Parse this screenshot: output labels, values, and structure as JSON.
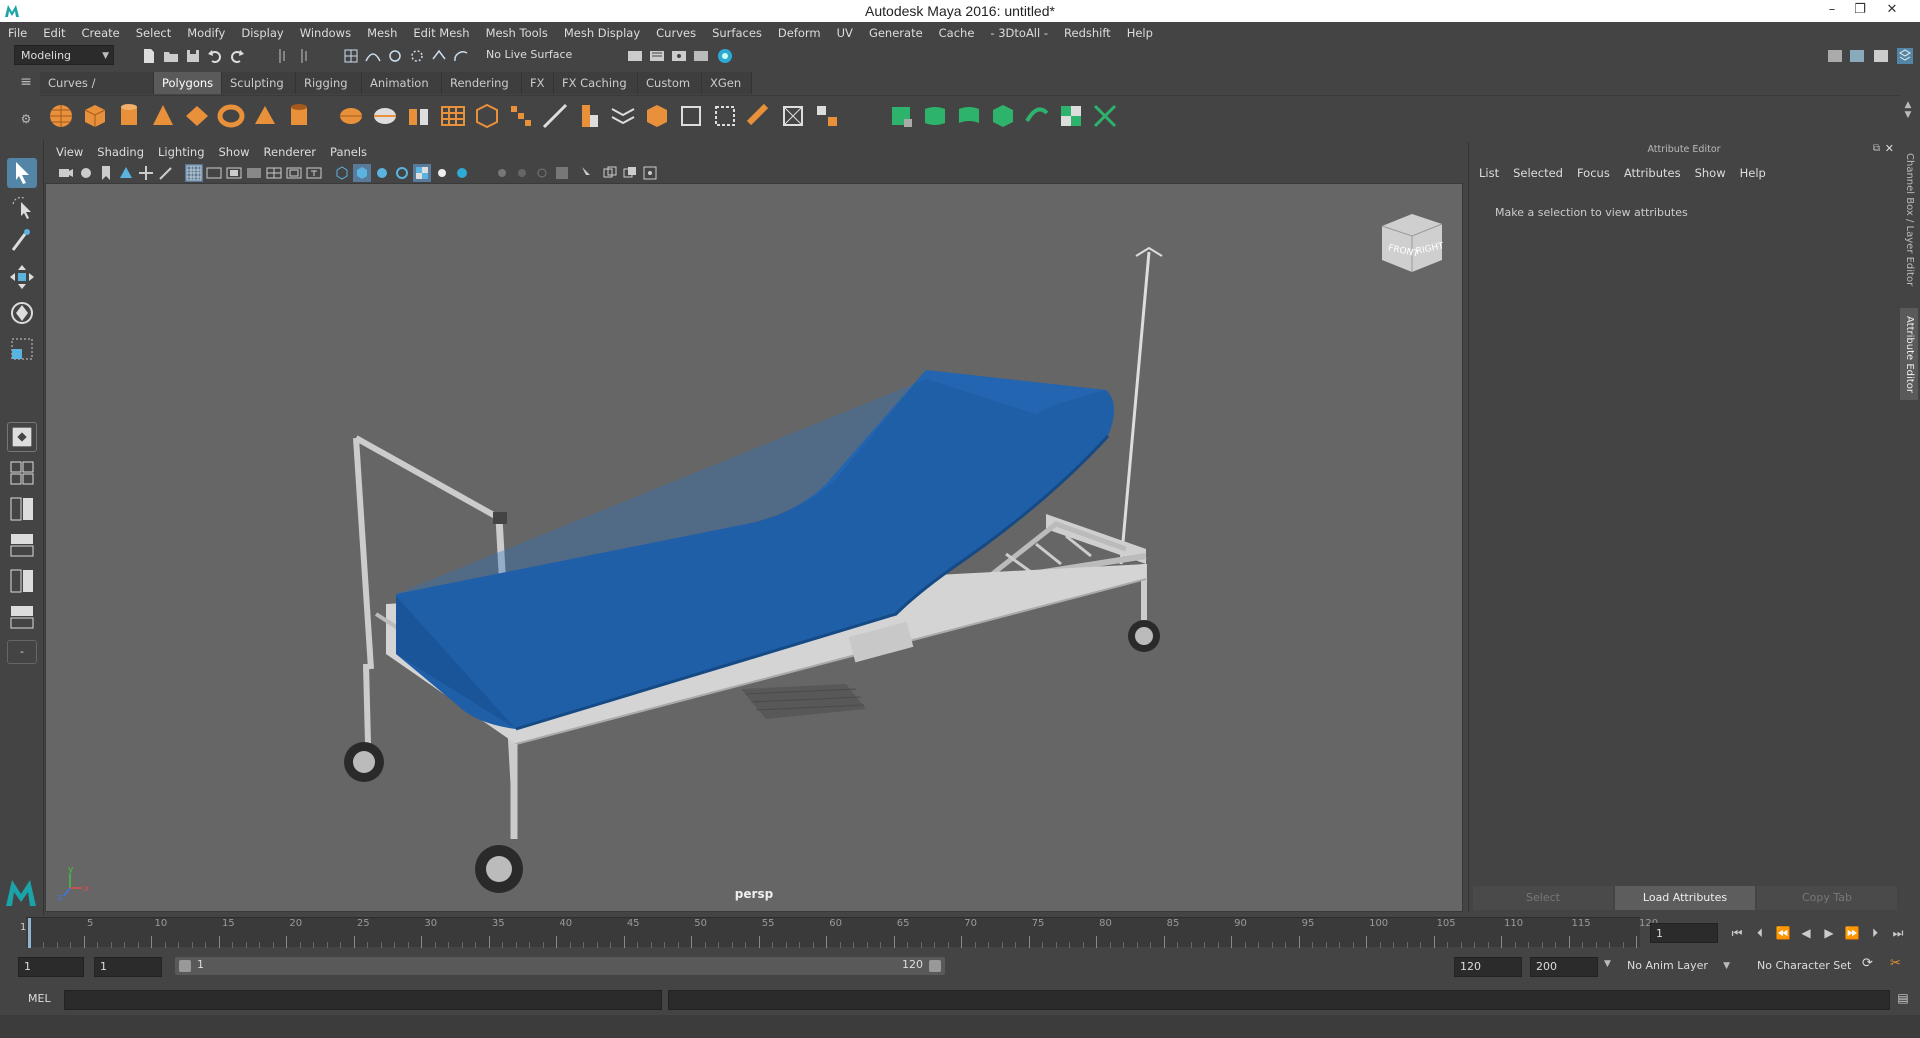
{
  "window": {
    "title": "Autodesk Maya 2016: untitled*",
    "controls": [
      "–",
      "❐",
      "✕"
    ]
  },
  "menubar": [
    "File",
    "Edit",
    "Create",
    "Select",
    "Modify",
    "Display",
    "Windows",
    "Mesh",
    "Edit Mesh",
    "Mesh Tools",
    "Mesh Display",
    "Curves",
    "Surfaces",
    "Deform",
    "UV",
    "Generate",
    "Cache",
    "- 3DtoAll -",
    "Redshift",
    "Help"
  ],
  "statusline": {
    "menuset": "Modeling",
    "live_surface": "No Live Surface"
  },
  "shelf": {
    "tabs": [
      "Curves / Surfaces",
      "Polygons",
      "Sculpting",
      "Rigging",
      "Animation",
      "Rendering",
      "FX",
      "FX Caching",
      "Custom",
      "XGen"
    ],
    "active_tab": "Polygons"
  },
  "panel": {
    "menu": [
      "View",
      "Shading",
      "Lighting",
      "Show",
      "Renderer",
      "Panels"
    ],
    "camera": "persp",
    "viewcube": {
      "front": "FRONT",
      "right": "RIGHT"
    },
    "axis": {
      "x": "x",
      "y": "y",
      "z": "z"
    }
  },
  "attribute_editor": {
    "header": "Attribute Editor",
    "menu": [
      "List",
      "Selected",
      "Focus",
      "Attributes",
      "Show",
      "Help"
    ],
    "hint": "Make a selection to view attributes",
    "buttons": {
      "select": "Select",
      "load": "Load Attributes",
      "copy": "Copy Tab"
    }
  },
  "side_tabs": {
    "channel_box": "Channel Box / Layer Editor",
    "attribute_editor": "Attribute Editor"
  },
  "timeline": {
    "labels": [
      "5",
      "10",
      "15",
      "20",
      "25",
      "30",
      "35",
      "40",
      "45",
      "50",
      "55",
      "60",
      "65",
      "70",
      "75",
      "80",
      "85",
      "90",
      "95",
      "100",
      "105",
      "110",
      "115",
      "120"
    ],
    "start_label": "1",
    "current_frame": "1"
  },
  "range": {
    "start": "1",
    "anim_start": "1",
    "slider_start": "1",
    "slider_end": "120",
    "end": "120",
    "anim_end": "200",
    "anim_layer": "No Anim Layer",
    "character_set": "No Character Set"
  },
  "command": {
    "lang": "MEL"
  },
  "colors": {
    "accent": "#5285a6",
    "mattress": "#1f5fa8",
    "viewport_bg": "#666666"
  }
}
